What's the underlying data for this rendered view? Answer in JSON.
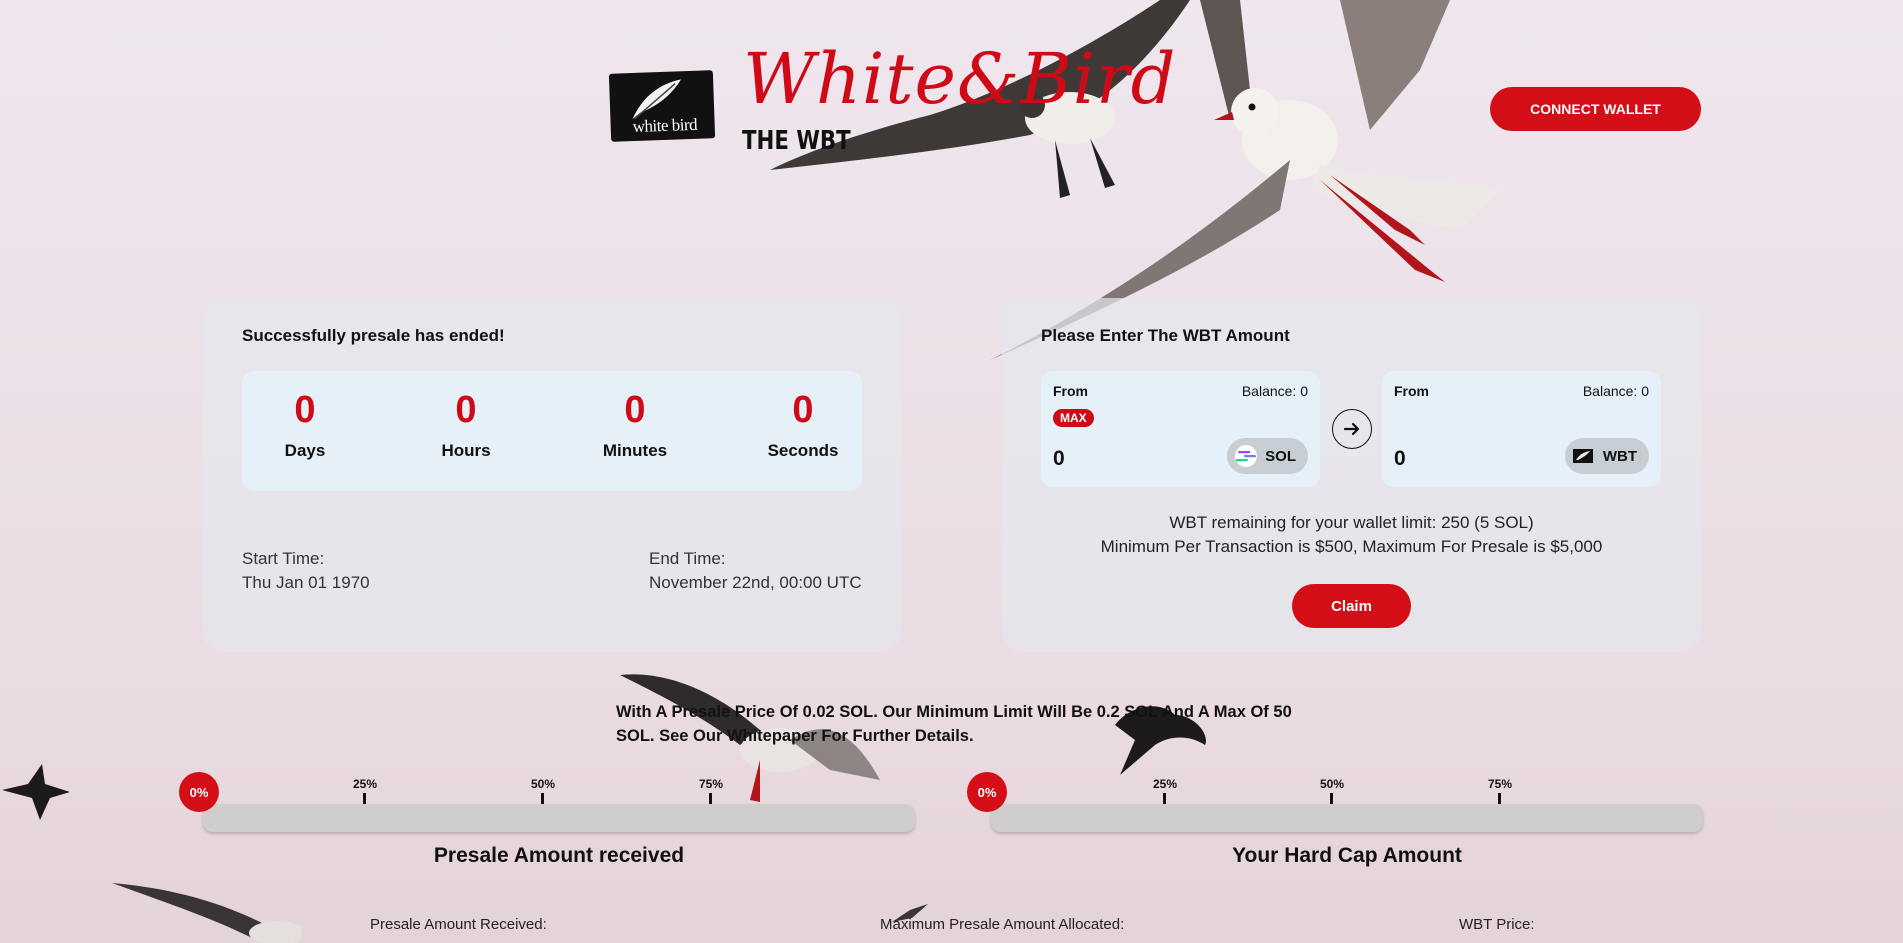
{
  "header": {
    "logo_text": "white bird",
    "brand_title": "White&Bird",
    "brand_subtitle": "THE WBT",
    "connect_label": "CONNECT WALLET"
  },
  "presale_panel": {
    "title": "Successfully presale has ended!",
    "countdown": [
      {
        "value": "0",
        "label": "Days"
      },
      {
        "value": "0",
        "label": "Hours"
      },
      {
        "value": "0",
        "label": "Minutes"
      },
      {
        "value": "0",
        "label": "Seconds"
      }
    ],
    "start_label": "Start Time:",
    "start_value": "Thu Jan 01 1970",
    "end_label": "End Time:",
    "end_value": "November 22nd, 00:00 UTC"
  },
  "swap_panel": {
    "title": "Please Enter The WBT Amount",
    "from_box": {
      "from_label": "From",
      "balance": "Balance: 0",
      "max_label": "MAX",
      "value": "0",
      "token": "SOL",
      "token_icon": "solana-icon"
    },
    "to_box": {
      "from_label": "From",
      "balance": "Balance: 0",
      "value": "0",
      "token": "WBT",
      "token_icon": "wbt-icon"
    },
    "remaining_text": "WBT remaining for your wallet limit: 250 (5 SOL)",
    "limits_text": "Minimum Per Transaction is $500, Maximum For Presale is $5,000",
    "claim_label": "Claim"
  },
  "notice": "With A Presale Price Of 0.02 SOL. Our Minimum Limit Will Be 0.2 SOL And A Max Of 50 SOL. See Our Whitepaper For Further Details.",
  "progress": [
    {
      "title": "Presale Amount received",
      "percent_label": "0%",
      "fill_fraction": 0,
      "ticks": [
        "25%",
        "50%",
        "75%"
      ]
    },
    {
      "title": "Your Hard Cap Amount",
      "percent_label": "0%",
      "fill_fraction": 0,
      "ticks": [
        "25%",
        "50%",
        "75%"
      ]
    }
  ],
  "stats": [
    {
      "label": "Presale Amount Received:"
    },
    {
      "label": "Maximum Presale Amount Allocated:"
    },
    {
      "label": "WBT Price:"
    }
  ],
  "colors": {
    "accent": "#d30e17",
    "panel": "#e4e8ed",
    "inner_panel": "#e6f0f8"
  }
}
